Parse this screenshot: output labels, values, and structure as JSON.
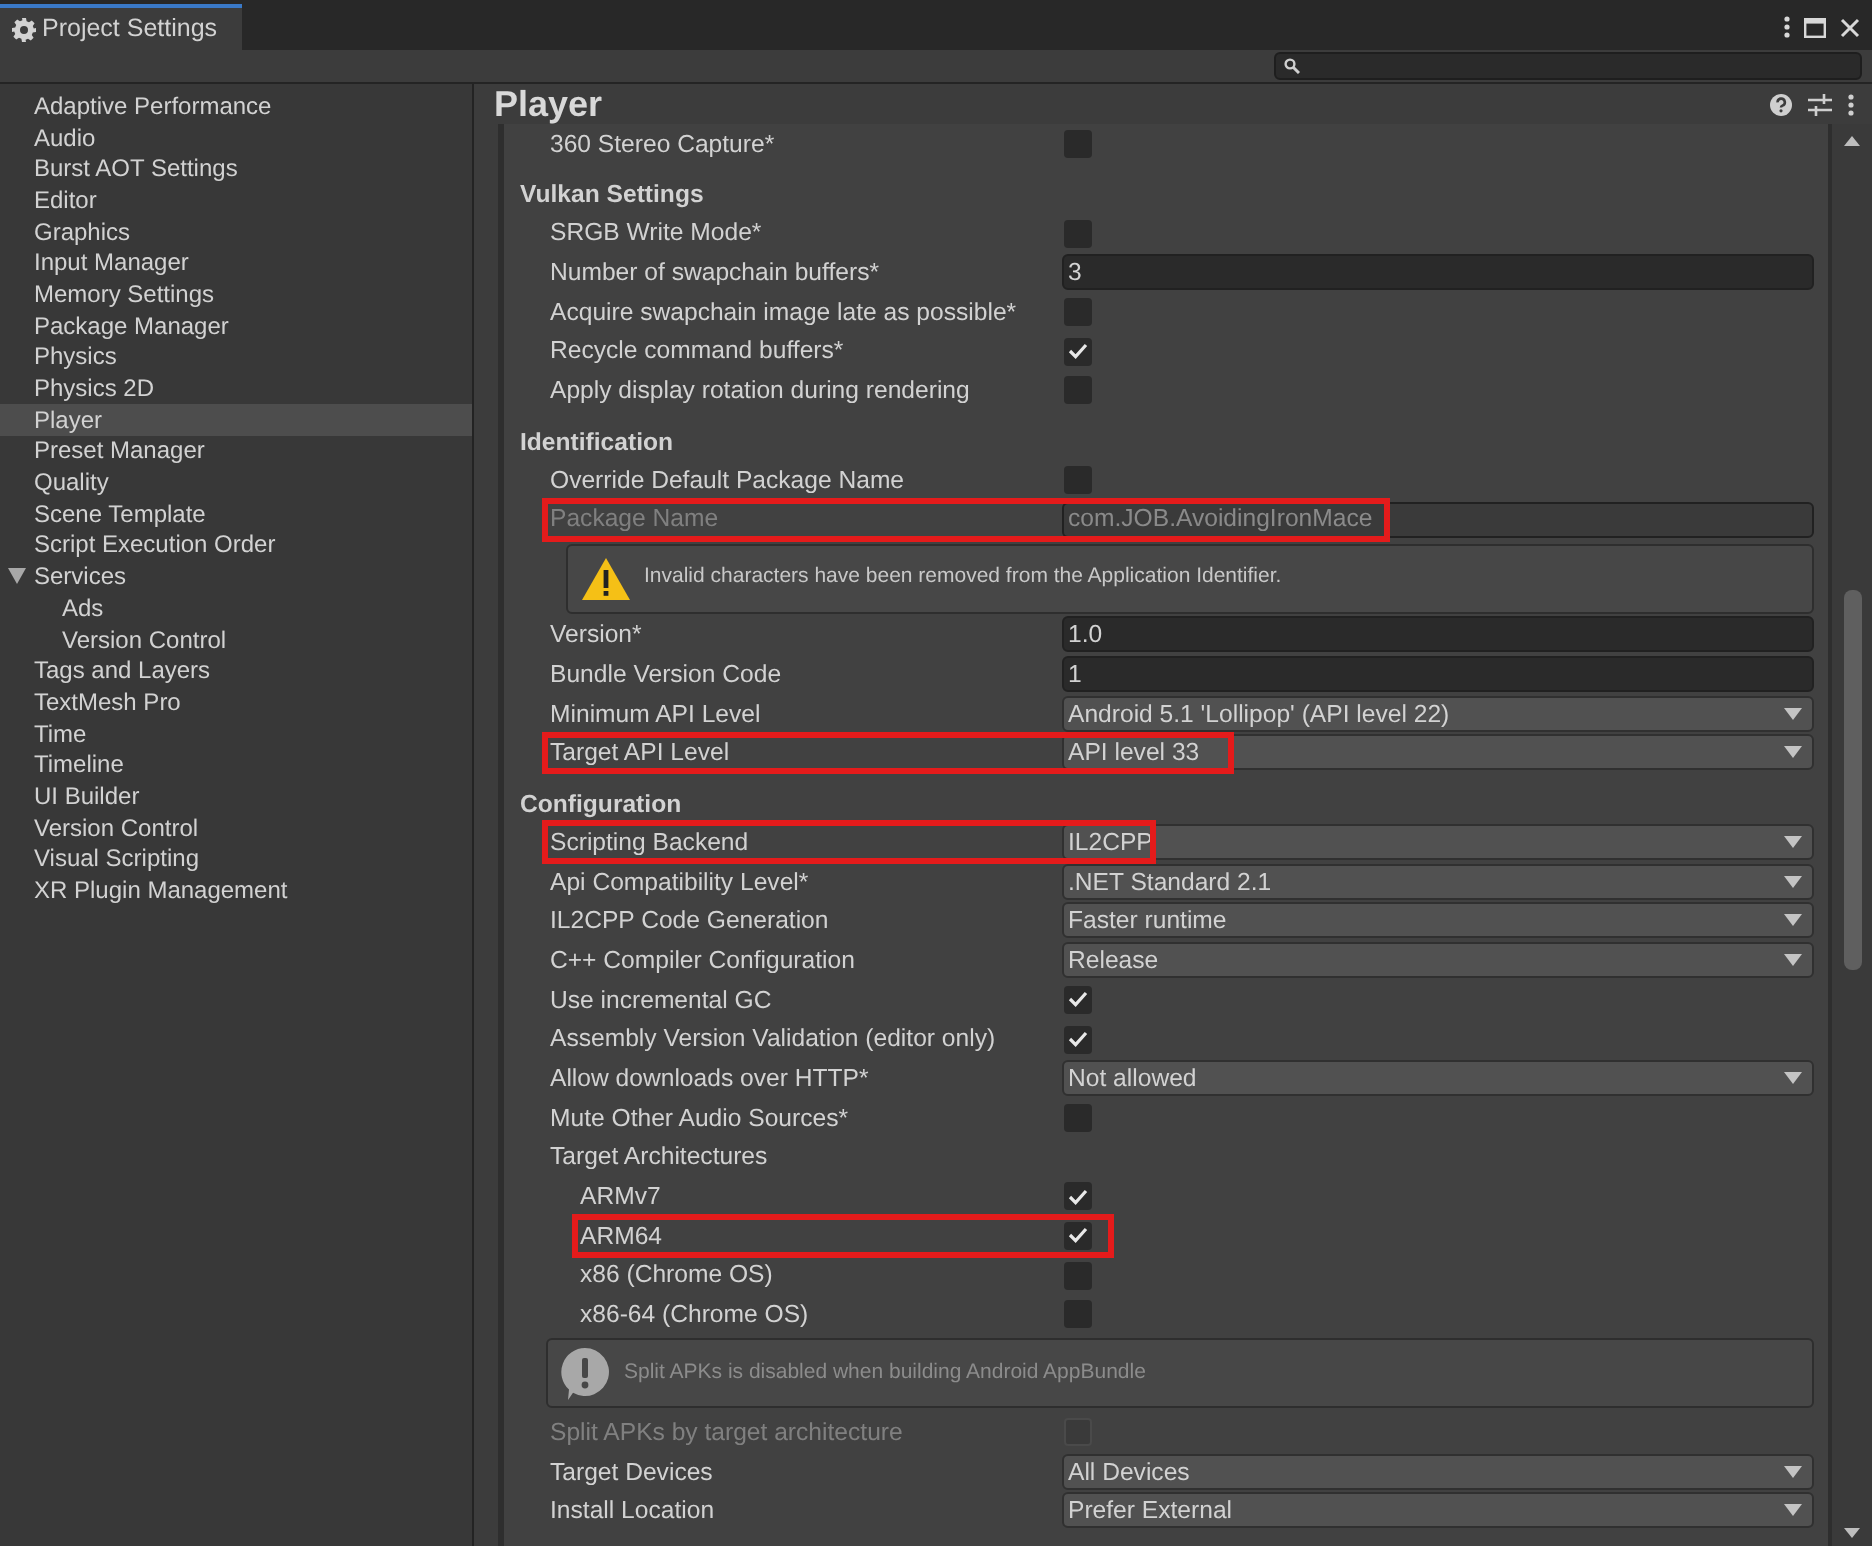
{
  "window": {
    "tab_title": "Project Settings"
  },
  "sidebar": {
    "items": [
      {
        "label": "Adaptive Performance",
        "selected": false
      },
      {
        "label": "Audio",
        "selected": false
      },
      {
        "label": "Burst AOT Settings",
        "selected": false
      },
      {
        "label": "Editor",
        "selected": false
      },
      {
        "label": "Graphics",
        "selected": false
      },
      {
        "label": "Input Manager",
        "selected": false
      },
      {
        "label": "Memory Settings",
        "selected": false
      },
      {
        "label": "Package Manager",
        "selected": false
      },
      {
        "label": "Physics",
        "selected": false
      },
      {
        "label": "Physics 2D",
        "selected": false
      },
      {
        "label": "Player",
        "selected": true
      },
      {
        "label": "Preset Manager",
        "selected": false
      },
      {
        "label": "Quality",
        "selected": false
      },
      {
        "label": "Scene Template",
        "selected": false
      },
      {
        "label": "Script Execution Order",
        "selected": false
      },
      {
        "label": "Services",
        "selected": false,
        "expanded": true,
        "children": [
          {
            "label": "Ads",
            "selected": false
          },
          {
            "label": "Version Control",
            "selected": false
          }
        ]
      },
      {
        "label": "Tags and Layers",
        "selected": false
      },
      {
        "label": "TextMesh Pro",
        "selected": false
      },
      {
        "label": "Time",
        "selected": false
      },
      {
        "label": "Timeline",
        "selected": false
      },
      {
        "label": "UI Builder",
        "selected": false
      },
      {
        "label": "Version Control",
        "selected": false
      },
      {
        "label": "Visual Scripting",
        "selected": false
      },
      {
        "label": "XR Plugin Management",
        "selected": false
      }
    ]
  },
  "inspector": {
    "title": "Player",
    "rows": [
      {
        "kind": "checkbox",
        "label": "360 Stereo Capture*",
        "checked": false,
        "disabled": false,
        "highlighted": false
      },
      {
        "kind": "header",
        "label": "Vulkan Settings"
      },
      {
        "kind": "checkbox",
        "label": "SRGB Write Mode*",
        "checked": false,
        "disabled": false,
        "highlighted": false
      },
      {
        "kind": "text",
        "label": "Number of swapchain buffers*",
        "value": "3",
        "disabled": false,
        "highlighted": false
      },
      {
        "kind": "checkbox",
        "label": "Acquire swapchain image late as possible*",
        "checked": false,
        "disabled": false,
        "highlighted": false
      },
      {
        "kind": "checkbox",
        "label": "Recycle command buffers*",
        "checked": true,
        "disabled": false,
        "highlighted": false
      },
      {
        "kind": "checkbox",
        "label": "Apply display rotation during rendering",
        "checked": false,
        "disabled": false,
        "highlighted": false
      },
      {
        "kind": "header",
        "label": "Identification"
      },
      {
        "kind": "checkbox",
        "label": "Override Default Package Name",
        "checked": false,
        "disabled": false,
        "highlighted": false
      },
      {
        "kind": "text",
        "label": "Package Name",
        "value": "com.JOB.AvoidingIronMace",
        "disabled": true,
        "highlighted": true
      },
      {
        "kind": "warning",
        "text": "Invalid characters have been removed from the Application Identifier."
      },
      {
        "kind": "text",
        "label": "Version*",
        "value": "1.0",
        "disabled": false,
        "highlighted": false
      },
      {
        "kind": "text",
        "label": "Bundle Version Code",
        "value": "1",
        "disabled": false,
        "highlighted": false
      },
      {
        "kind": "dropdown",
        "label": "Minimum API Level",
        "value": "Android 5.1 'Lollipop' (API level 22)",
        "disabled": false,
        "highlighted": false
      },
      {
        "kind": "dropdown",
        "label": "Target API Level",
        "value": "API level 33",
        "disabled": false,
        "highlighted": true
      },
      {
        "kind": "header",
        "label": "Configuration"
      },
      {
        "kind": "dropdown",
        "label": "Scripting Backend",
        "value": "IL2CPP",
        "disabled": false,
        "highlighted": true
      },
      {
        "kind": "dropdown",
        "label": "Api Compatibility Level*",
        "value": ".NET Standard 2.1",
        "disabled": false,
        "highlighted": false
      },
      {
        "kind": "dropdown",
        "label": "IL2CPP Code Generation",
        "value": "Faster runtime",
        "disabled": false,
        "highlighted": false
      },
      {
        "kind": "dropdown",
        "label": "C++ Compiler Configuration",
        "value": "Release",
        "disabled": false,
        "highlighted": false
      },
      {
        "kind": "checkbox",
        "label": "Use incremental GC",
        "checked": true,
        "disabled": false,
        "highlighted": false
      },
      {
        "kind": "checkbox",
        "label": "Assembly Version Validation (editor only)",
        "checked": true,
        "disabled": false,
        "highlighted": false
      },
      {
        "kind": "dropdown",
        "label": "Allow downloads over HTTP*",
        "value": "Not allowed",
        "disabled": false,
        "highlighted": false
      },
      {
        "kind": "checkbox",
        "label": "Mute Other Audio Sources*",
        "checked": false,
        "disabled": false,
        "highlighted": false
      },
      {
        "kind": "group",
        "label": "Target Architectures",
        "children": [
          {
            "kind": "checkbox",
            "label": "ARMv7",
            "checked": true,
            "disabled": false,
            "highlighted": false
          },
          {
            "kind": "checkbox",
            "label": "ARM64",
            "checked": true,
            "disabled": false,
            "highlighted": true
          },
          {
            "kind": "checkbox",
            "label": "x86 (Chrome OS)",
            "checked": false,
            "disabled": false,
            "highlighted": false
          },
          {
            "kind": "checkbox",
            "label": "x86-64 (Chrome OS)",
            "checked": false,
            "disabled": false,
            "highlighted": false
          }
        ]
      },
      {
        "kind": "info",
        "text": "Split APKs is disabled when building Android AppBundle"
      },
      {
        "kind": "checkbox",
        "label": "Split APKs by target architecture",
        "checked": false,
        "disabled": true,
        "highlighted": false
      },
      {
        "kind": "dropdown",
        "label": "Target Devices",
        "value": "All Devices",
        "disabled": false,
        "highlighted": false
      },
      {
        "kind": "dropdown",
        "label": "Install Location",
        "value": "Prefer External",
        "disabled": false,
        "highlighted": false
      }
    ]
  }
}
